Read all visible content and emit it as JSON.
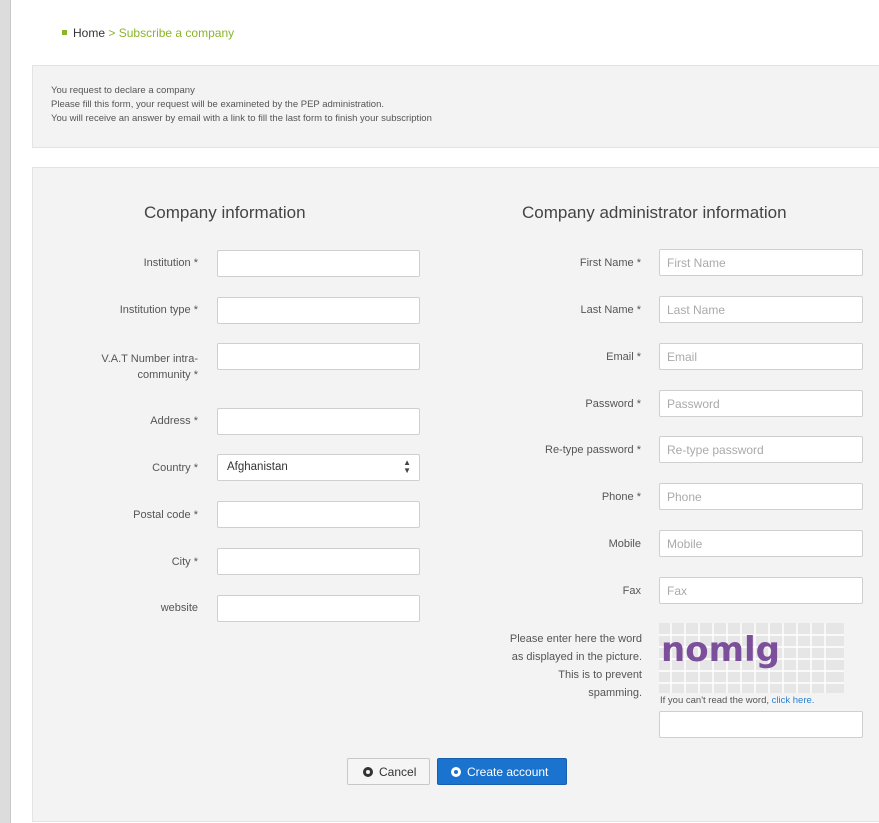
{
  "breadcrumb": {
    "home": "Home",
    "separator": ">",
    "current": "Subscribe a company"
  },
  "notice": {
    "line1": "You request to declare a company",
    "line2": "Please fill this form, your request will be examineted by the PEP administration.",
    "line3": "You will receive an answer by email with a link to fill the last form to finish your subscription"
  },
  "company": {
    "title": "Company information",
    "institution_label": "Institution *",
    "institution_type_label": "Institution type *",
    "vat_label_line1": "V.A.T Number intra-",
    "vat_label_line2": "community *",
    "address_label": "Address *",
    "country_label": "Country *",
    "country_value": "Afghanistan",
    "postal_label": "Postal code *",
    "city_label": "City *",
    "website_label": "website"
  },
  "admin": {
    "title": "Company administrator information",
    "first_name_label": "First Name *",
    "first_name_placeholder": "First Name",
    "last_name_label": "Last Name *",
    "last_name_placeholder": "Last Name",
    "email_label": "Email *",
    "email_placeholder": "Email",
    "password_label": "Password *",
    "password_placeholder": "Password",
    "retype_label": "Re-type password *",
    "retype_placeholder": "Re-type password",
    "phone_label": "Phone *",
    "phone_placeholder": "Phone",
    "mobile_label": "Mobile",
    "mobile_placeholder": "Mobile",
    "fax_label": "Fax",
    "fax_placeholder": "Fax"
  },
  "captcha": {
    "line1": "Please enter here the word",
    "line2": "as displayed in the picture.",
    "line3": "This is to prevent",
    "line4": "spamming.",
    "word": "nomlg",
    "hint": "If you can't read the word,",
    "link": "click here."
  },
  "buttons": {
    "cancel": "Cancel",
    "create": "Create account"
  }
}
